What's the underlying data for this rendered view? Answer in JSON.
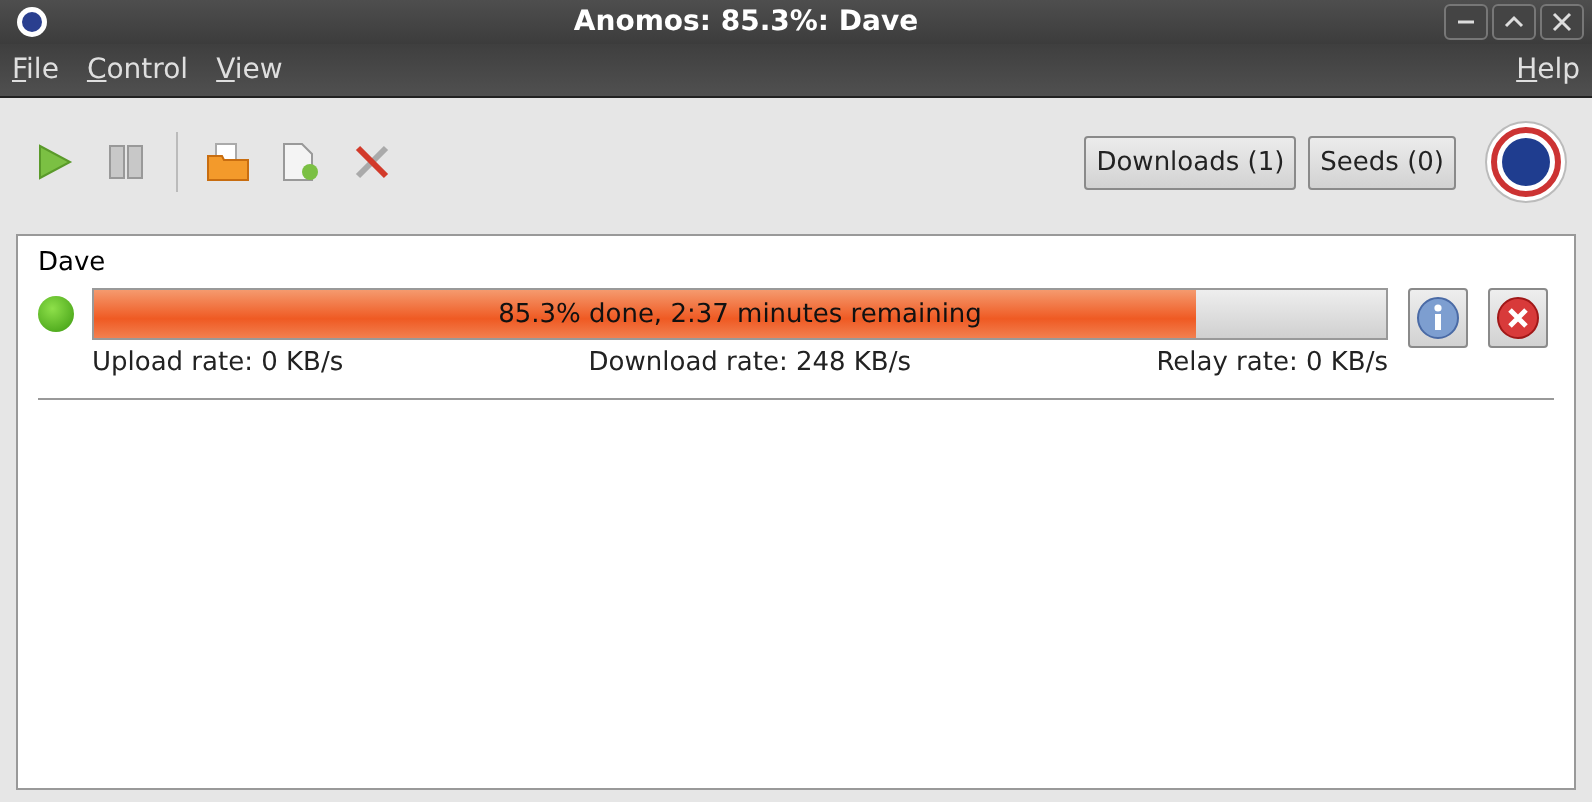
{
  "window": {
    "title": "Anomos: 85.3%: Dave"
  },
  "menu": [
    {
      "label": "File"
    },
    {
      "label": "Control"
    },
    {
      "label": "View"
    },
    {
      "label": "Help"
    }
  ],
  "toolbar": {
    "tabs": [
      {
        "label": "Downloads (1)"
      },
      {
        "label": "Seeds (0)"
      }
    ]
  },
  "torrents": [
    {
      "name": "Dave",
      "active": true,
      "level": 0.853,
      "progress_text": "85.3% done, 2:37 minutes remaining",
      "upload": "Upload rate: 0 KB/s",
      "download": "Download rate: 248 KB/s",
      "relay": "Relay rate: 0 KB/s"
    }
  ]
}
